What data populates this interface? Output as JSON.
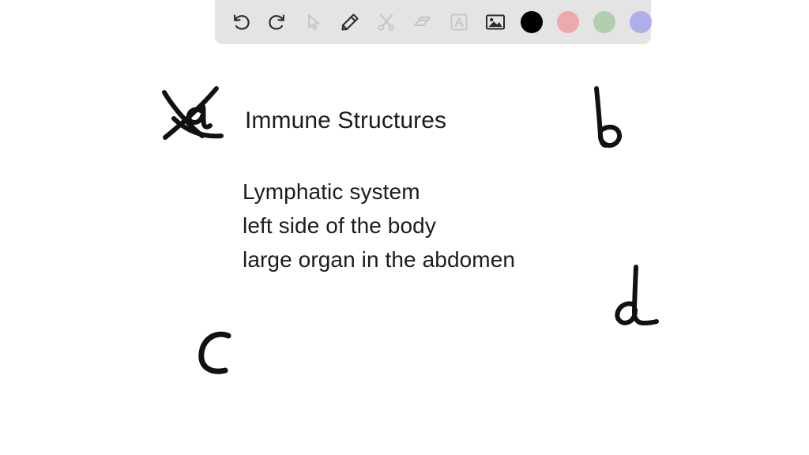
{
  "app": {
    "canvas_background": "#ffffff",
    "ink_color": "#111111"
  },
  "toolbar": {
    "background": "#e4e4e4",
    "tools": [
      {
        "name": "undo-icon",
        "label": "Undo",
        "state": "enabled"
      },
      {
        "name": "redo-icon",
        "label": "Redo",
        "state": "enabled"
      },
      {
        "name": "select-icon",
        "label": "Select",
        "state": "disabled"
      },
      {
        "name": "pencil-icon",
        "label": "Pencil",
        "state": "enabled"
      },
      {
        "name": "scissors-icon",
        "label": "Cut",
        "state": "disabled"
      },
      {
        "name": "eraser-icon",
        "label": "Eraser",
        "state": "disabled"
      },
      {
        "name": "text-icon",
        "label": "Text",
        "state": "disabled"
      },
      {
        "name": "image-icon",
        "label": "Insert image",
        "state": "enabled"
      }
    ],
    "color_swatches": [
      {
        "name": "color-swatch-black",
        "label": "Black",
        "color": "#000000",
        "selected": true
      },
      {
        "name": "color-swatch-pink",
        "label": "Pink",
        "color": "#eca9ae",
        "selected": false
      },
      {
        "name": "color-swatch-green",
        "label": "Green",
        "color": "#afcfaf",
        "selected": false
      },
      {
        "name": "color-swatch-purple",
        "label": "Purple",
        "color": "#aeaeea",
        "selected": false
      }
    ]
  },
  "content": {
    "heading": "Immune Structures",
    "lines": [
      "Lymphatic system",
      "left side of the body",
      "large organ in the abdomen"
    ]
  },
  "annotations": [
    {
      "name": "handwritten-a-crossed-out",
      "text": "a",
      "crossed_out": true
    },
    {
      "name": "handwritten-b",
      "text": "b",
      "crossed_out": false
    },
    {
      "name": "handwritten-c",
      "text": "C",
      "crossed_out": false
    },
    {
      "name": "handwritten-d",
      "text": "d",
      "crossed_out": false
    }
  ]
}
